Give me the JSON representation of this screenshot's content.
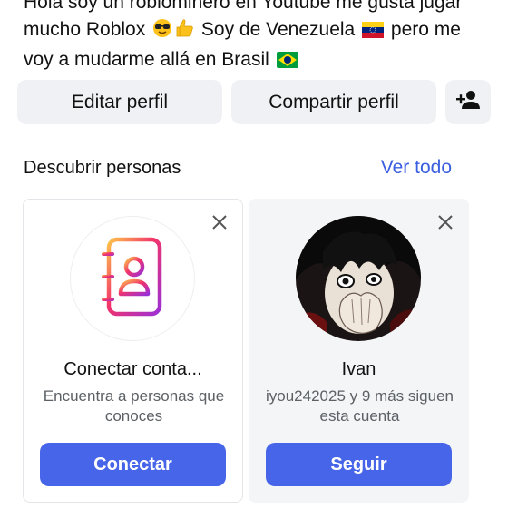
{
  "bio": {
    "line1": "Hola soy un roblominero en Youtube me gusta jugar",
    "line2": "mucho Roblox",
    "line2_tail": " Soy de Venezuela",
    "line2_end": " pero me",
    "line3": "voy a mudarme allá en Brasil"
  },
  "actions": {
    "edit_label": "Editar perfil",
    "share_label": "Compartir perfil",
    "add_icon": "person-add-icon"
  },
  "discover": {
    "title": "Descubrir personas",
    "see_all": "Ver todo"
  },
  "cards": [
    {
      "name": "Conectar conta...",
      "subtitle": "Encuentra a personas que conoces",
      "button": "Conectar",
      "icon": "contacts-book-icon"
    },
    {
      "name": "Ivan",
      "subtitle": "iyou242025 y 9 más siguen esta cuenta",
      "button": "Seguir",
      "icon": "profile-photo"
    }
  ],
  "colors": {
    "accent": "#4765e8",
    "link": "#3b5fe0",
    "button_grey": "#eff1f4"
  }
}
